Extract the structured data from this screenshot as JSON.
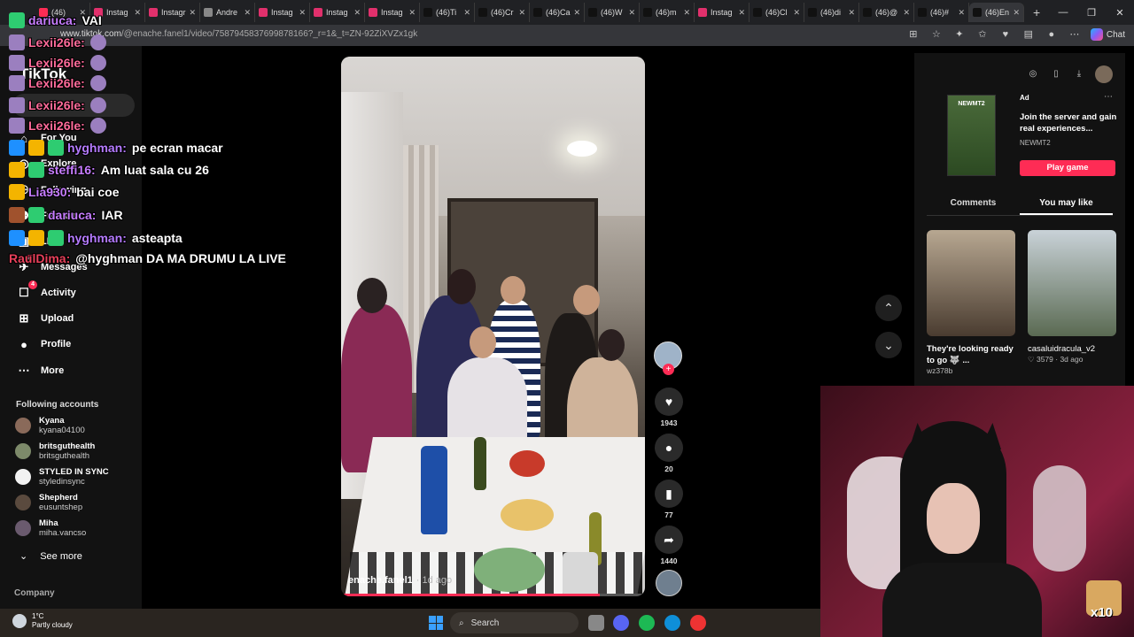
{
  "browser": {
    "tabs": [
      {
        "label": "(46)",
        "color": "#fe2c55"
      },
      {
        "label": "Instag",
        "color": "#e1306c"
      },
      {
        "label": "Instagr",
        "color": "#e1306c"
      },
      {
        "label": "Andre",
        "color": "#888888"
      },
      {
        "label": "Instag",
        "color": "#e1306c"
      },
      {
        "label": "Instag",
        "color": "#e1306c"
      },
      {
        "label": "Instag",
        "color": "#e1306c"
      },
      {
        "label": "(46)Ti",
        "color": "#111111"
      },
      {
        "label": "(46)Cr",
        "color": "#111111"
      },
      {
        "label": "(46)Ca",
        "color": "#111111"
      },
      {
        "label": "(46)W",
        "color": "#111111"
      },
      {
        "label": "(46)m",
        "color": "#111111"
      },
      {
        "label": "Instag",
        "color": "#e1306c"
      },
      {
        "label": "(46)Cl",
        "color": "#111111"
      },
      {
        "label": "(46)di",
        "color": "#111111"
      },
      {
        "label": "(46)@",
        "color": "#111111"
      },
      {
        "label": "(46)#",
        "color": "#111111"
      },
      {
        "label": "(46)En",
        "color": "#111111",
        "active": true
      }
    ],
    "url_host": "www.tiktok.com",
    "url_path": "/@enache.fanel1/video/7587945837699878166?_r=1&_t=ZN-92ZiXVZx1gk",
    "chat_label": "Chat"
  },
  "tiktok": {
    "logo": "TikTok",
    "nav": [
      {
        "label": "For You",
        "icon": "home-icon",
        "glyph": "⌂"
      },
      {
        "label": "Explore",
        "icon": "compass-icon",
        "glyph": "◎"
      },
      {
        "label": "Following",
        "icon": "following-icon",
        "glyph": "⚇"
      },
      {
        "label": "Friends",
        "icon": "friends-icon",
        "glyph": "⚉"
      },
      {
        "label": "LIVE",
        "icon": "live-icon",
        "glyph": "▣"
      },
      {
        "label": "Messages",
        "icon": "messages-icon",
        "glyph": "✈",
        "badge": "40"
      },
      {
        "label": "Activity",
        "icon": "activity-icon",
        "glyph": "☐",
        "badge": "4"
      },
      {
        "label": "Upload",
        "icon": "upload-icon",
        "glyph": "⊞"
      },
      {
        "label": "Profile",
        "icon": "profile-icon",
        "glyph": "●"
      },
      {
        "label": "More",
        "icon": "more-icon",
        "glyph": "⋯"
      }
    ],
    "following_title": "Following accounts",
    "accounts": [
      {
        "name": "Kyana",
        "handle": "kyana04100",
        "color": "#8a6a5a"
      },
      {
        "name": "britsguthealth",
        "handle": "britsguthealth",
        "color": "#7d8a6a"
      },
      {
        "name": "STYLED IN SYNC",
        "handle": "styledinsync",
        "color": "#f2f2f2"
      },
      {
        "name": "Shepherd",
        "handle": "eusuntshep",
        "color": "#5a4a3e"
      },
      {
        "name": "Miha",
        "handle": "miha.vancso",
        "color": "#6a5a6e"
      }
    ],
    "see_more": "See more",
    "company": "Company"
  },
  "chat": [
    {
      "user": "dariuca:",
      "msg": "VAI",
      "color": "#c77dff",
      "badges": [
        "#2ecc71"
      ]
    },
    {
      "user": "Lexii26le:",
      "msg": "",
      "color": "#ff6b9a",
      "badges": [
        "#9b7fbf"
      ]
    },
    {
      "user": "Lexii26le:",
      "msg": "",
      "color": "#ff6b9a",
      "badges": [
        "#9b7fbf"
      ]
    },
    {
      "user": "Lexii26le:",
      "msg": "",
      "color": "#ff6b9a",
      "badges": [
        "#9b7fbf"
      ]
    },
    {
      "user": "Lexii26le:",
      "msg": "",
      "color": "#ff6b9a",
      "badges": [
        "#9b7fbf"
      ]
    },
    {
      "user": "Lexii26le:",
      "msg": "",
      "color": "#ff6b9a",
      "badges": [
        "#9b7fbf"
      ]
    },
    {
      "user": "hyghman:",
      "msg": "pe ecran macar",
      "color": "#b57bff",
      "badges": [
        "#1e90ff",
        "#f4b400",
        "#2ecc71"
      ]
    },
    {
      "user": "steffi16:",
      "msg": "Am luat sala cu 26",
      "color": "#c77dff",
      "badges": [
        "#f4b400",
        "#2ecc71"
      ]
    },
    {
      "user": "Lia930:",
      "msg": "bai coe",
      "color": "#c77dff",
      "badges": [
        "#f4b400"
      ]
    },
    {
      "user": "dariuca:",
      "msg": "IAR",
      "color": "#c77dff",
      "badges": [
        "#a0522d",
        "#2ecc71"
      ]
    },
    {
      "user": "hyghman:",
      "msg": "asteapta",
      "color": "#b57bff",
      "badges": [
        "#1e90ff",
        "#f4b400",
        "#2ecc71"
      ]
    },
    {
      "user": "RaulDima:",
      "msg": "@hyghman DA MA DRUMU LA LIVE",
      "color": "#e8405a",
      "badges": []
    }
  ],
  "video": {
    "author": "enache.fanel1",
    "age": "· 1d ago",
    "progress": 0.85,
    "likes": "1943",
    "comments": "20",
    "saves": "77",
    "shares": "1440"
  },
  "right_panel": {
    "ad_image_text": "NEWMT2",
    "ad_tag": "Ad",
    "ad_title": "Join the server and gain real experiences...",
    "ad_brand": "NEWMT2",
    "play_label": "Play game",
    "tabs": [
      "Comments",
      "You may like"
    ],
    "active_tab": 1,
    "recs": [
      {
        "caption": "They're looking ready to go 🐺 ...",
        "meta": "wz378b"
      },
      {
        "caption": "casaluidracula_v2",
        "meta": "♡ 3579 · 3d ago"
      }
    ]
  },
  "webcam": {
    "multiplier": "x10"
  },
  "taskbar": {
    "temp": "1°C",
    "weather": "Partly cloudy",
    "search_label": "Search"
  }
}
